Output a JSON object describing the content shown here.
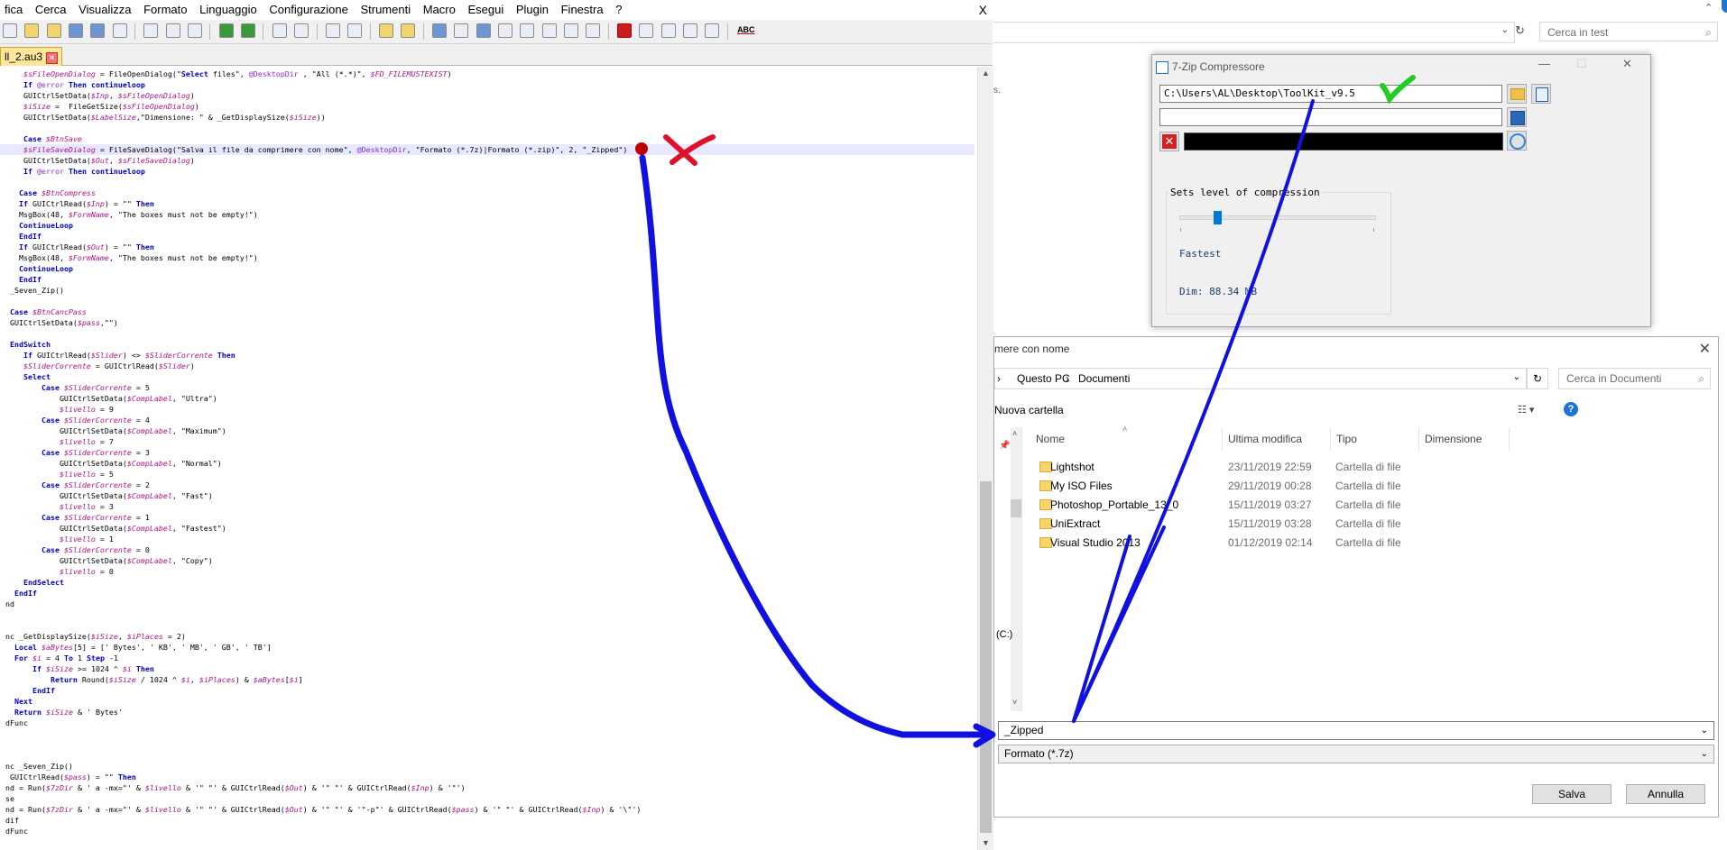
{
  "editor": {
    "menu": [
      "fica",
      "Cerca",
      "Visualizza",
      "Formato",
      "Linguaggio",
      "Configurazione",
      "Strumenti",
      "Macro",
      "Esegui",
      "Plugin",
      "Finestra",
      "?"
    ],
    "close": "X",
    "tab_label": "ll_2.au3",
    "spell_icon_text": "ABC",
    "lines": [
      {
        "t": "    $sFileOpenDialog = FileOpenDialog(\"Select files\", @DesktopDir , \"All (*.*)\", $FD_FILEMUSTEXIST)"
      },
      {
        "t": "    If @error Then continueloop"
      },
      {
        "t": "    GUICtrlSetData($Inp, $sFileOpenDialog)"
      },
      {
        "t": "    $iSize =  FileGetSize($sFileOpenDialog)"
      },
      {
        "t": "    GUICtrlSetData($LabelSize,\"Dimensione: \" & _GetDisplaySize($iSize))"
      },
      {
        "t": ""
      },
      {
        "t": "    Case $BtnSave"
      },
      {
        "t": "    $sFileSaveDialog = FileSaveDialog(\"Salva il file da comprimere con nome\", @DesktopDir, \"Formato (*.7z)|Formato (*.zip)\", 2, \"_Zipped\")"
      },
      {
        "t": "    GUICtrlSetData($Out, $sFileSaveDialog)"
      },
      {
        "t": "    If @error Then continueloop"
      },
      {
        "t": ""
      },
      {
        "t": "   Case $BtnCompress"
      },
      {
        "t": "   If GUICtrlRead($Inp) = \"\" Then"
      },
      {
        "t": "   MsgBox(48, $FormName, \"The boxes must not be empty!\")"
      },
      {
        "t": "   ContinueLoop"
      },
      {
        "t": "   EndIf"
      },
      {
        "t": "   If GUICtrlRead($Out) = \"\" Then"
      },
      {
        "t": "   MsgBox(48, $FormName, \"The boxes must not be empty!\")"
      },
      {
        "t": "   ContinueLoop"
      },
      {
        "t": "   EndIf"
      },
      {
        "t": " _Seven_Zip()"
      },
      {
        "t": ""
      },
      {
        "t": " Case $BtnCancPass"
      },
      {
        "t": " GUICtrlSetData($pass,\"\")"
      },
      {
        "t": ""
      },
      {
        "t": " EndSwitch"
      },
      {
        "t": "    If GUICtrlRead($Slider) <> $SliderCorrente Then"
      },
      {
        "t": "    $SliderCorrente = GUICtrlRead($Slider)"
      },
      {
        "t": "    Select"
      },
      {
        "t": "        Case $SliderCorrente = 5"
      },
      {
        "t": "            GUICtrlSetData($CompLabel, \"Ultra\")"
      },
      {
        "t": "            $livello = 9"
      },
      {
        "t": "        Case $SliderCorrente = 4"
      },
      {
        "t": "            GUICtrlSetData($CompLabel, \"Maximum\")"
      },
      {
        "t": "            $livello = 7"
      },
      {
        "t": "        Case $SliderCorrente = 3"
      },
      {
        "t": "            GUICtrlSetData($CompLabel, \"Normal\")"
      },
      {
        "t": "            $livello = 5"
      },
      {
        "t": "        Case $SliderCorrente = 2"
      },
      {
        "t": "            GUICtrlSetData($CompLabel, \"Fast\")"
      },
      {
        "t": "            $livello = 3"
      },
      {
        "t": "        Case $SliderCorrente = 1"
      },
      {
        "t": "            GUICtrlSetData($CompLabel, \"Fastest\")"
      },
      {
        "t": "            $livello = 1"
      },
      {
        "t": "        Case $SliderCorrente = 0"
      },
      {
        "t": "            GUICtrlSetData($CompLabel, \"Copy\")"
      },
      {
        "t": "            $livello = 0"
      },
      {
        "t": "    EndSelect"
      },
      {
        "t": "  EndIf"
      },
      {
        "t": "nd"
      },
      {
        "t": ""
      },
      {
        "t": ""
      },
      {
        "t": "nc _GetDisplaySize($iSize, $iPlaces = 2)"
      },
      {
        "t": "  Local $aBytes[5] = [' Bytes', ' KB', ' MB', ' GB', ' TB']"
      },
      {
        "t": "  For $i = 4 To 1 Step -1"
      },
      {
        "t": "      If $iSize >= 1024 ^ $i Then"
      },
      {
        "t": "          Return Round($iSize / 1024 ^ $i, $iPlaces) & $aBytes[$i]"
      },
      {
        "t": "      EndIf"
      },
      {
        "t": "  Next"
      },
      {
        "t": "  Return $iSize & ' Bytes'"
      },
      {
        "t": "dFunc"
      },
      {
        "t": ""
      },
      {
        "t": ""
      },
      {
        "t": ""
      },
      {
        "t": "nc _Seven_Zip()"
      },
      {
        "t": " GUICtrlRead($pass) = \"\" Then"
      },
      {
        "t": "nd = Run($7zDir & ' a -mx=\"' & $livello & '\" \"' & GUICtrlRead($Out) & '\" \"' & GUICtrlRead($Inp) & '\"')"
      },
      {
        "t": "se"
      },
      {
        "t": "nd = Run($7zDir & ' a -mx=\"' & $livello & '\" \"' & GUICtrlRead($Out) & '\" \"' & '\"-p\"' & GUICtrlRead($pass) & '\" \"' & GUICtrlRead($Inp) & '\\\"')"
      },
      {
        "t": "dif"
      },
      {
        "t": "dFunc"
      }
    ]
  },
  "background": {
    "search_placeholder": "Cerca in test",
    "side_fragment": "s."
  },
  "zip_window": {
    "title": "7-Zip Compressore",
    "input_path": "C:\\Users\\AL\\Desktop\\ToolKit_v9.5",
    "output_path": "",
    "group_label": "Sets level of compression",
    "level_label": "Fastest",
    "size_label": "Dim: 88.34 MB",
    "slider_level_fraction": 0.2
  },
  "save_dialog": {
    "title": "mere con nome",
    "breadcrumb": [
      "Questo PC",
      "Documenti"
    ],
    "search_placeholder": "Cerca in Documenti",
    "new_folder": "Nuova cartella",
    "columns": [
      "Nome",
      "Ultima modifica",
      "Tipo",
      "Dimensione"
    ],
    "files": [
      {
        "name": "Lightshot",
        "date": "23/11/2019 22:59",
        "type": "Cartella di file"
      },
      {
        "name": "My ISO Files",
        "date": "29/11/2019 00:28",
        "type": "Cartella di file"
      },
      {
        "name": "Photoshop_Portable_13_0",
        "date": "15/11/2019 03:27",
        "type": "Cartella di file"
      },
      {
        "name": "UniExtract",
        "date": "15/11/2019 03:28",
        "type": "Cartella di file"
      },
      {
        "name": "Visual Studio 2013",
        "date": "01/12/2019 02:14",
        "type": "Cartella di file"
      }
    ],
    "nav_drive_fragment": "(C:)",
    "filename": "_Zipped",
    "filetype": "Formato (*.7z)",
    "save_button": "Salva",
    "cancel_button": "Annulla"
  },
  "colors": {
    "annotation_blue": "#1010e0",
    "annotation_red": "#e0102a",
    "annotation_green": "#22cc22"
  }
}
